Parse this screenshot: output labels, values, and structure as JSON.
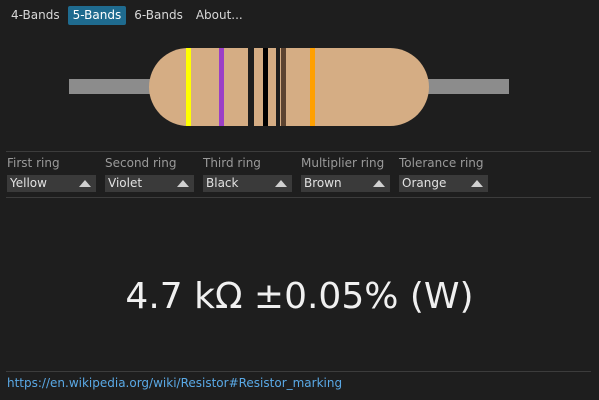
{
  "tabs": [
    {
      "label": "4-Bands",
      "active": false
    },
    {
      "label": "5-Bands",
      "active": true
    },
    {
      "label": "6-Bands",
      "active": false
    },
    {
      "label": "About...",
      "active": false
    }
  ],
  "resistor": {
    "body_color": "#d5ad84",
    "lead_color": "#8c8c8c",
    "bands": [
      {
        "name": "First ring",
        "color": "#ffff00"
      },
      {
        "name": "Second ring",
        "color": "#9c3fc6"
      },
      {
        "name": "Third ring",
        "color": "#000000"
      },
      {
        "name": "Multiplier ring",
        "color": "#5c4330"
      },
      {
        "name": "Tolerance ring",
        "color": "#ffa000"
      }
    ]
  },
  "rings": [
    {
      "label": "First ring",
      "value": "Yellow"
    },
    {
      "label": "Second ring",
      "value": "Violet"
    },
    {
      "label": "Third ring",
      "value": "Black"
    },
    {
      "label": "Multiplier ring",
      "value": "Brown"
    },
    {
      "label": "Tolerance ring",
      "value": "Orange"
    }
  ],
  "result": "4.7 kΩ ±0.05% (W)",
  "footer": {
    "link": "https://en.wikipedia.org/wiki/Resistor#Resistor_marking"
  },
  "colors": {
    "accent": "#1f6b8f",
    "link": "#5aa9e6",
    "background": "#1e1e1e"
  }
}
